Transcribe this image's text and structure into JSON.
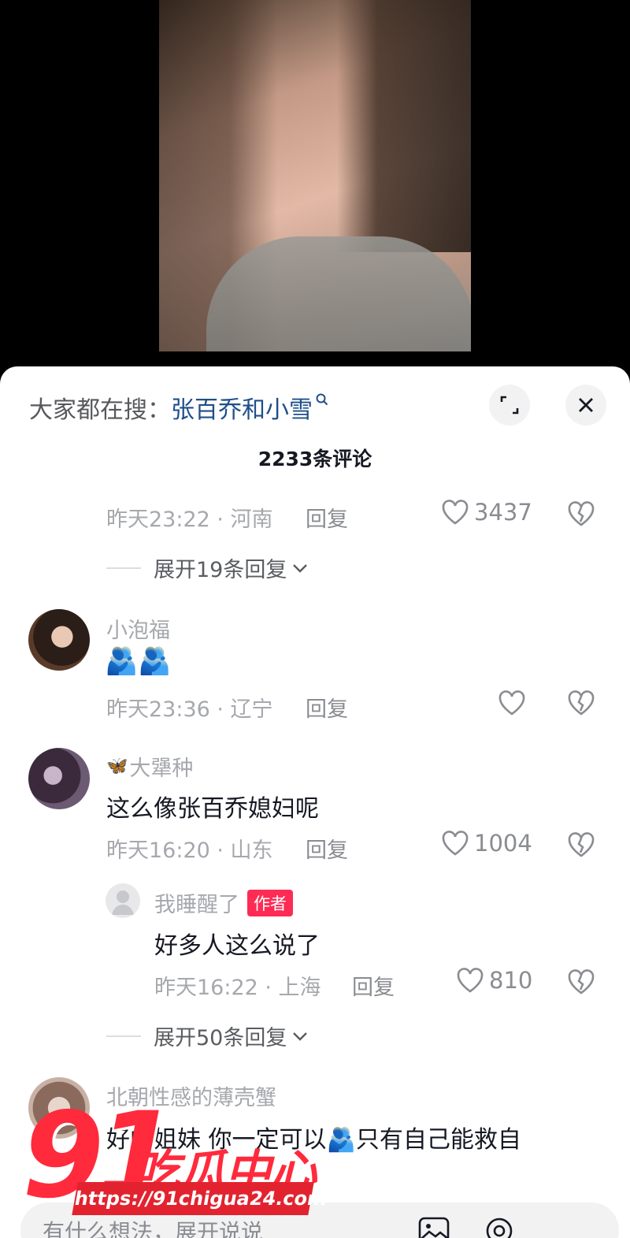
{
  "sheet": {
    "search_prefix": "大家都在搜：",
    "search_term": "张百乔和小雪",
    "comment_count": "2233条评论"
  },
  "comments": [
    {
      "meta": "昨天23:22 · 河南",
      "reply": "回复",
      "likes": "3437",
      "expand": "展开19条回复"
    },
    {
      "name": "小泡福",
      "emoji": "🫂🫂",
      "meta": "昨天23:36 · 辽宁",
      "reply": "回复",
      "likes": ""
    },
    {
      "name_icon": "🦋",
      "name": "大犟种",
      "text": "这么像张百乔媳妇呢",
      "meta": "昨天16:20 · 山东",
      "reply": "回复",
      "likes": "1004"
    },
    {
      "name": "我睡醒了",
      "tag": "作者",
      "text": "好多人这么说了",
      "meta": "昨天16:22 · 上海",
      "reply": "回复",
      "likes": "810",
      "expand": "展开50条回复"
    },
    {
      "name": "北朝性感的薄壳蟹",
      "text": "好的姐妹 你一定可以🫂只有自己能救自"
    }
  ],
  "input": {
    "placeholder": "有什么想法，展开说说"
  },
  "watermark": {
    "big": "91",
    "cn": "吃瓜中心",
    "url": "https://91chigua24.com"
  },
  "colors": {
    "accent": "#fe2c55",
    "link": "#1f4f8a"
  }
}
